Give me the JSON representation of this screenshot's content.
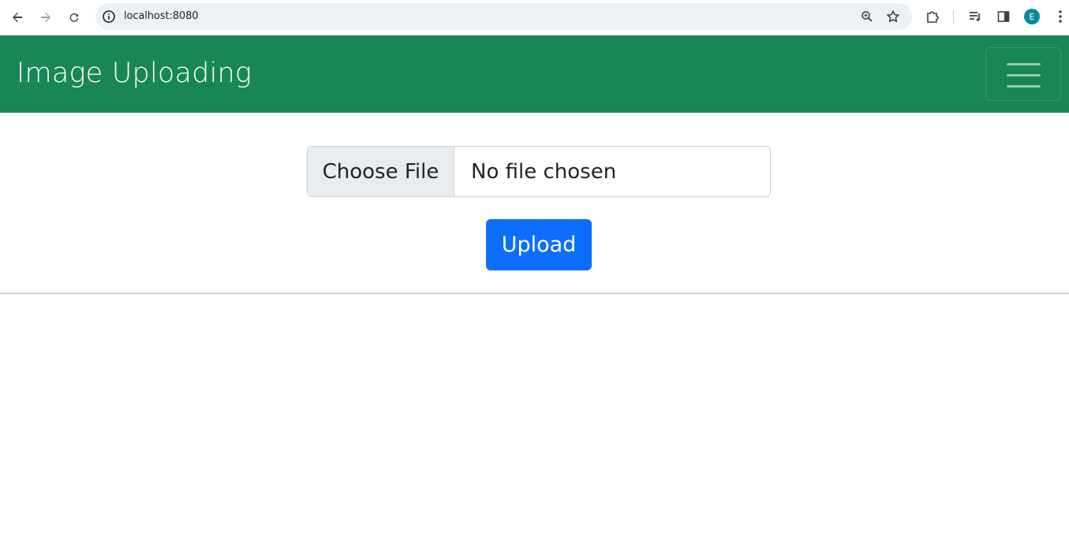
{
  "browser": {
    "url": "localhost:8080",
    "profile_initial": "E",
    "icons": [
      "back-icon",
      "forward-icon",
      "reload-icon",
      "site-info-icon",
      "zoom-icon",
      "bookmark-star-icon",
      "extensions-icon",
      "reading-list-icon",
      "side-panel-icon",
      "menu-kebab-icon"
    ]
  },
  "navbar": {
    "brand": "Image Uploading",
    "background": "#198754"
  },
  "form": {
    "file_button_label": "Choose File",
    "file_status": "No file chosen",
    "upload_label": "Upload",
    "upload_color": "#0d6efd"
  }
}
